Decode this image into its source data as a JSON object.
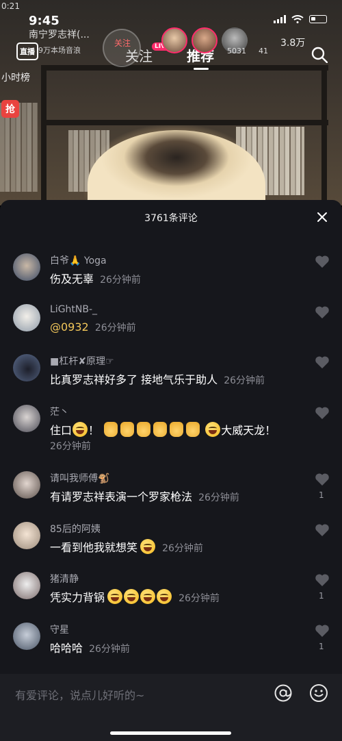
{
  "status_bar": {
    "time_small": "0:21",
    "time": "9:45"
  },
  "top": {
    "live_button": "直播",
    "streamer_name": "南宁罗志祥(...",
    "streamer_sub": "9万本场音浪",
    "follow_small": "关注",
    "tab_follow": "关注",
    "tab_recommend": "推荐",
    "live_badge": "LIVE",
    "viewer_count": "5031",
    "viewer_count_2": "41",
    "fans": "3.8万",
    "hour_rank": "小时榜",
    "side_icon": "抢"
  },
  "panel": {
    "title": "3761条评论",
    "close_icon": "close-icon"
  },
  "comments": [
    {
      "name": "白爷🙏 Yoga",
      "text": "伤及无辜",
      "time": "26分钟前",
      "likes": ""
    },
    {
      "name": "LiGhtNB-_",
      "text": "@0932",
      "time": "26分钟前",
      "likes": ""
    },
    {
      "name": "■杠杆✘原理☞",
      "text": "比真罗志祥好多了 接地气乐于助人",
      "time": "26分钟前",
      "likes": ""
    },
    {
      "name": "茫丶",
      "text_before": "住口",
      "text_mid": "！",
      "text_after": "大威天龙！",
      "time": "26分钟前",
      "likes": ""
    },
    {
      "name": "请叫我师傅🐒",
      "text": "有请罗志祥表演一个罗家枪法",
      "time": "26分钟前",
      "likes": "1"
    },
    {
      "name": "85后的阿姨",
      "text": "一看到他我就想笑",
      "time": "26分钟前",
      "likes": ""
    },
    {
      "name": "猪清静",
      "text": "凭实力背锅",
      "time": "26分钟前",
      "likes": "1"
    },
    {
      "name": "守星",
      "text": "哈哈哈",
      "time": "26分钟前",
      "likes": "1"
    }
  ],
  "bottom": {
    "placeholder": "有爱评论，说点儿好听的~"
  },
  "colors": {
    "panel_bg": "#16171c",
    "mention": "#f2c75a",
    "live_badge": "#ff2b6b"
  }
}
